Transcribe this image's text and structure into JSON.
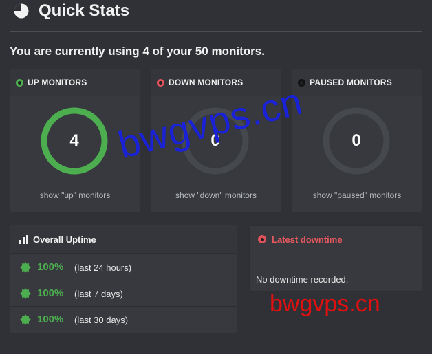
{
  "header": {
    "title": "Quick Stats",
    "icon": "pie-chart-icon"
  },
  "usage_text": "You are currently using 4 of your 50 monitors.",
  "cards": [
    {
      "label": "UP MONITORS",
      "count": "4",
      "link": "show \"up\" monitors",
      "color": "#4cae4f",
      "filled": true
    },
    {
      "label": "DOWN MONITORS",
      "count": "0",
      "link": "show \"down\" monitors",
      "color": "#e0525b",
      "filled": false
    },
    {
      "label": "PAUSED MONITORS",
      "count": "0",
      "link": "show \"paused\" monitors",
      "color": "#1f2023",
      "filled": false
    }
  ],
  "uptime": {
    "title": "Overall Uptime",
    "icon": "bar-chart-icon",
    "rows": [
      {
        "pct": "100%",
        "period": "(last 24 hours)"
      },
      {
        "pct": "100%",
        "period": "(last 7 days)"
      },
      {
        "pct": "100%",
        "period": "(last 30 days)"
      }
    ],
    "badge_color": "#4cae4f"
  },
  "downtime": {
    "title": "Latest downtime",
    "message": "No downtime recorded."
  },
  "watermarks": {
    "blue": "bwgvps.cn",
    "red": "bwgvps.cn"
  },
  "colors": {
    "background": "#2f3136",
    "panel": "#37393e",
    "ring_empty": "#45484d",
    "green": "#4cae4f",
    "red": "#e0525b"
  }
}
